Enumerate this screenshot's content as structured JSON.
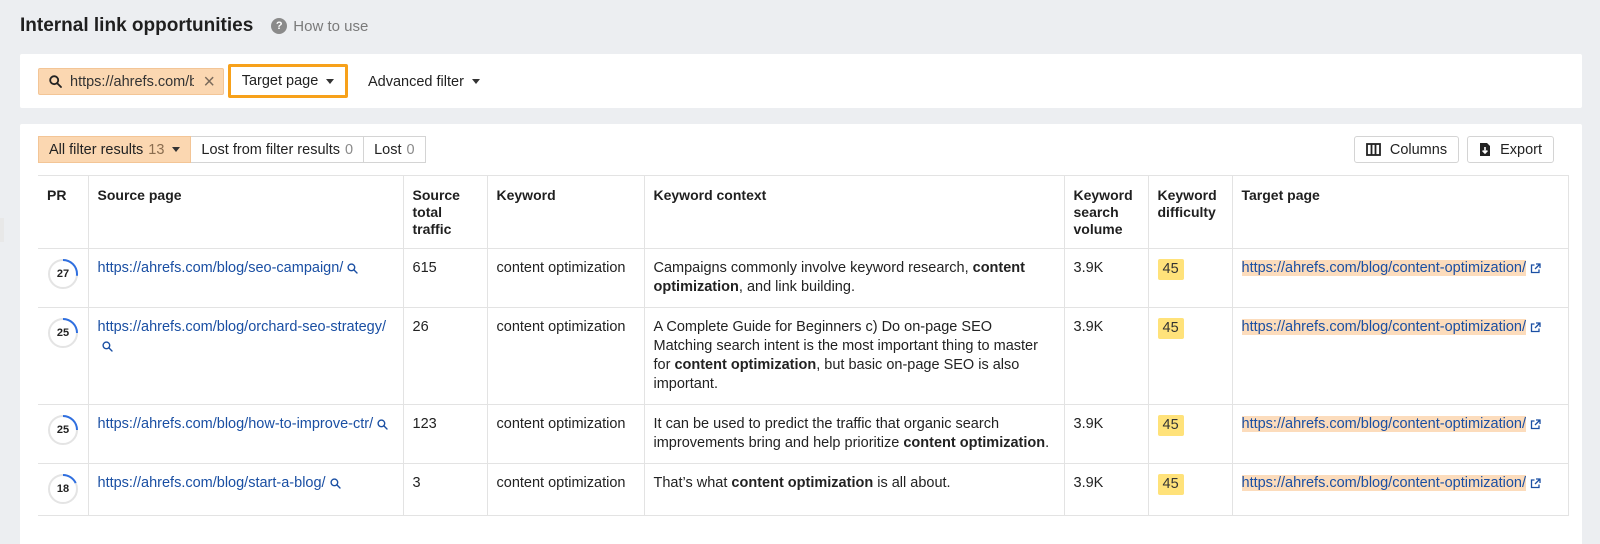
{
  "header": {
    "title": "Internal link opportunities",
    "how_to_use": "How to use"
  },
  "filter_bar": {
    "search_value": "https://ahrefs.com/blog/content-optimization/",
    "target_label": "Target page",
    "advanced_label": "Advanced filter"
  },
  "tabs": [
    {
      "label": "All filter results",
      "count": "13",
      "active": true
    },
    {
      "label": "Lost from filter results",
      "count": "0",
      "active": false
    },
    {
      "label": "Lost",
      "count": "0",
      "active": false
    }
  ],
  "toolbar": {
    "columns_label": "Columns",
    "export_label": "Export"
  },
  "table": {
    "headers": {
      "pr": "PR",
      "source": "Source page",
      "traffic": "Source total traffic",
      "keyword": "Keyword",
      "context": "Keyword context",
      "volume": "Keyword search volume",
      "kd": "Keyword difficulty",
      "target": "Target page"
    },
    "rows": [
      {
        "pr": "27",
        "pr_fraction": 0.27,
        "source": "https://ahrefs.com/blog/seo-campaign/",
        "traffic": "615",
        "keyword": "content optimization",
        "context_before": "Campaigns commonly involve keyword research, ",
        "context_bold": "content optimization",
        "context_after": ", and link building.",
        "volume": "3.9K",
        "kd": "45",
        "target": "https://ahrefs.com/blog/content-optimization/"
      },
      {
        "pr": "25",
        "pr_fraction": 0.25,
        "source": "https://ahrefs.com/blog/orchard-seo-strategy/",
        "traffic": "26",
        "keyword": "content optimization",
        "context_before": "A Complete Guide for Beginners c) Do on-page SEO Matching search intent is the most important thing to master for ",
        "context_bold": "content optimization",
        "context_after": ", but basic on-page SEO is also important.",
        "volume": "3.9K",
        "kd": "45",
        "target": "https://ahrefs.com/blog/content-optimization/"
      },
      {
        "pr": "25",
        "pr_fraction": 0.25,
        "source": "https://ahrefs.com/blog/how-to-improve-ctr/",
        "traffic": "123",
        "keyword": "content optimization",
        "context_before": "It can be used to predict the traffic that organic search improvements bring and help prioritize ",
        "context_bold": "content optimization",
        "context_after": ".",
        "volume": "3.9K",
        "kd": "45",
        "target": "https://ahrefs.com/blog/content-optimization/"
      },
      {
        "pr": "18",
        "pr_fraction": 0.18,
        "source": "https://ahrefs.com/blog/start-a-blog/",
        "traffic": "3",
        "keyword": "content optimization",
        "context_before": "That’s what ",
        "context_bold": "content optimization",
        "context_after": " is all about.",
        "volume": "3.9K",
        "kd": "45",
        "target": "https://ahrefs.com/blog/content-optimization/"
      }
    ]
  },
  "colors": {
    "accent_orange": "#f7a11a",
    "chip_peach": "#fbd7b1",
    "link_blue": "#1a4fa3",
    "kd_yellow": "#ffe27a",
    "pr_ring": "#2f6fe0"
  }
}
